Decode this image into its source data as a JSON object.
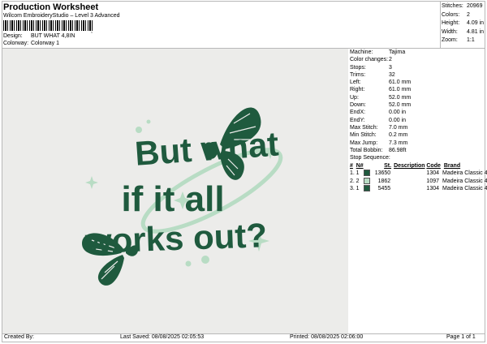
{
  "header": {
    "title": "Production Worksheet",
    "subtitle": "Wilcom EmbroideryStudio – Level 3 Advanced",
    "design_label": "Design:",
    "design_value": "BUT WHAT 4,8IN",
    "colorway_label": "Colorway:",
    "colorway_value": "Colorway 1"
  },
  "summary": [
    {
      "label": "Stitches:",
      "value": "20969"
    },
    {
      "label": "Colors:",
      "value": "2"
    },
    {
      "label": "Height:",
      "value": "4.09 in"
    },
    {
      "label": "Width:",
      "value": "4.81 in"
    },
    {
      "label": "Zoom:",
      "value": "1:1"
    }
  ],
  "machine_info": [
    {
      "label": "Machine:",
      "value": "Tajima"
    },
    {
      "label": "Color changes:",
      "value": "2"
    },
    {
      "label": "Stops:",
      "value": "3"
    },
    {
      "label": "Trims:",
      "value": "32"
    },
    {
      "label": "Left:",
      "value": "61.0 mm"
    },
    {
      "label": "Right:",
      "value": "61.0 mm"
    },
    {
      "label": "Up:",
      "value": "52.0 mm"
    },
    {
      "label": "Down:",
      "value": "52.0 mm"
    },
    {
      "label": "EndX:",
      "value": "0.00 in"
    },
    {
      "label": "EndY:",
      "value": "0.00 in"
    },
    {
      "label": "Max Stitch:",
      "value": "7.0 mm"
    },
    {
      "label": "Min Stitch:",
      "value": "0.2 mm"
    },
    {
      "label": "Max Jump:",
      "value": "7.3 mm"
    },
    {
      "label": "Total Bobbin:",
      "value": "86.98ft"
    }
  ],
  "stop_sequence": {
    "title": "Stop Sequence:",
    "headers": {
      "num": "#",
      "n": "N#",
      "st": "St.",
      "desc": "Description",
      "code": "Code",
      "brand": "Brand"
    },
    "rows": [
      {
        "num": "1.",
        "n": "1",
        "color": "#1f5a3e",
        "st": "13650",
        "desc": "",
        "code": "1304",
        "brand": "Madeira Classic 40"
      },
      {
        "num": "2.",
        "n": "2",
        "color": "#b8dcc4",
        "st": "1862",
        "desc": "",
        "code": "1097",
        "brand": "Madeira Classic 40"
      },
      {
        "num": "3.",
        "n": "1",
        "color": "#1f5a3e",
        "st": "5455",
        "desc": "",
        "code": "1304",
        "brand": "Madeira Classic 40"
      }
    ]
  },
  "design_text": {
    "line1": "But what",
    "line2": "if it all",
    "line3": "works out?"
  },
  "colors": {
    "dark_green": "#1f5a3e",
    "light_green": "#b8dcc4",
    "fabric": "#ececea"
  },
  "footer": {
    "created_by": "Created By:",
    "last_saved": "Last Saved: 08/08/2025 02:05:53",
    "printed": "Printed: 08/08/2025 02:06:00",
    "page": "Page 1 of 1"
  }
}
